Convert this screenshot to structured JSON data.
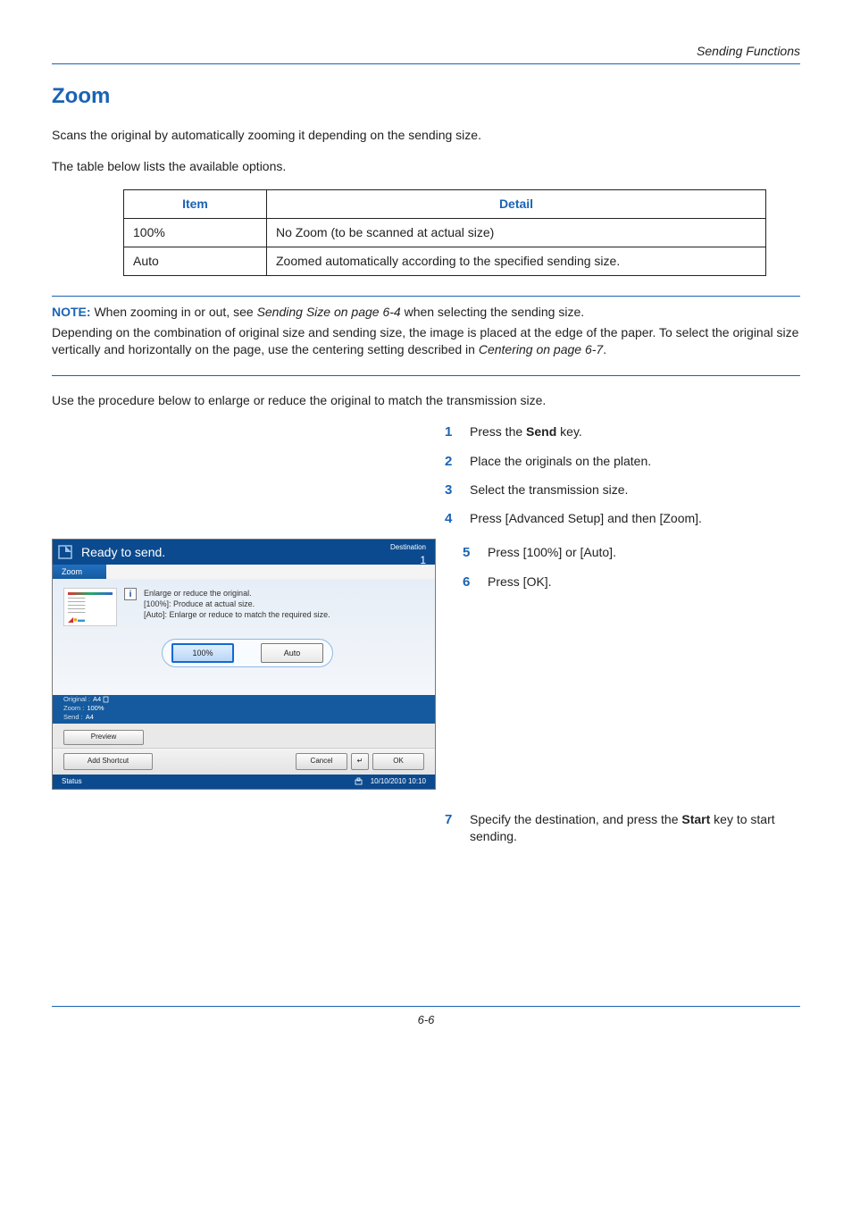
{
  "header": {
    "section": "Sending Functions"
  },
  "title": "Zoom",
  "intro1": "Scans the original by automatically zooming it depending on the sending size.",
  "intro2": "The table below lists the available options.",
  "table": {
    "head_item": "Item",
    "head_detail": "Detail",
    "rows": [
      {
        "item": "100%",
        "detail": "No Zoom (to be scanned at actual size)"
      },
      {
        "item": "Auto",
        "detail": "Zoomed automatically according to the specified sending size."
      }
    ]
  },
  "note": {
    "label": "NOTE:",
    "line1_a": " When zooming in or out, see ",
    "line1_ref": "Sending Size on page 6-4",
    "line1_b": " when selecting the sending size.",
    "line2": "Depending on the combination of original size and sending size, the image is placed at the edge of the paper. To select the original size vertically and horizontally on the page, use the centering setting described in ",
    "line2_ref": "Centering on page 6-7",
    "line2_end": "."
  },
  "procedure_intro": "Use the procedure below to enlarge or reduce the original to match the transmission size.",
  "steps_top": [
    {
      "n": "1",
      "pre": "Press the ",
      "bold": "Send",
      "post": " key."
    },
    {
      "n": "2",
      "pre": "Place the originals on the platen.",
      "bold": "",
      "post": ""
    },
    {
      "n": "3",
      "pre": "Select the transmission size.",
      "bold": "",
      "post": ""
    },
    {
      "n": "4",
      "pre": "Press [Advanced Setup] and then [Zoom].",
      "bold": "",
      "post": ""
    }
  ],
  "steps_right": [
    {
      "n": "5",
      "pre": "Press [100%] or [Auto].",
      "bold": "",
      "post": ""
    },
    {
      "n": "6",
      "pre": "Press [OK].",
      "bold": "",
      "post": ""
    }
  ],
  "step_final": {
    "n": "7",
    "pre": "Specify the destination, and press the ",
    "bold": "Start",
    "post": " key to start sending."
  },
  "panel": {
    "ready": "Ready to send.",
    "destination_label": "Destination",
    "destination_count": "1",
    "tab": "Zoom",
    "info_i": "i",
    "hint1": "Enlarge or reduce the original.",
    "hint2": "[100%]: Produce at actual size.",
    "hint3": "[Auto]: Enlarge or reduce to match the required size.",
    "opt_100": "100%",
    "opt_auto": "Auto",
    "original_lbl": "Original",
    "original_val": "A4",
    "zoom_lbl": "Zoom",
    "zoom_val": "100%",
    "send_lbl": "Send",
    "send_val": "A4",
    "preview": "Preview",
    "add_shortcut": "Add Shortcut",
    "cancel": "Cancel",
    "back_sym": "↵",
    "ok": "OK",
    "status": "Status",
    "timestamp": "10/10/2010  10:10"
  },
  "footer": {
    "page": "6-6"
  }
}
